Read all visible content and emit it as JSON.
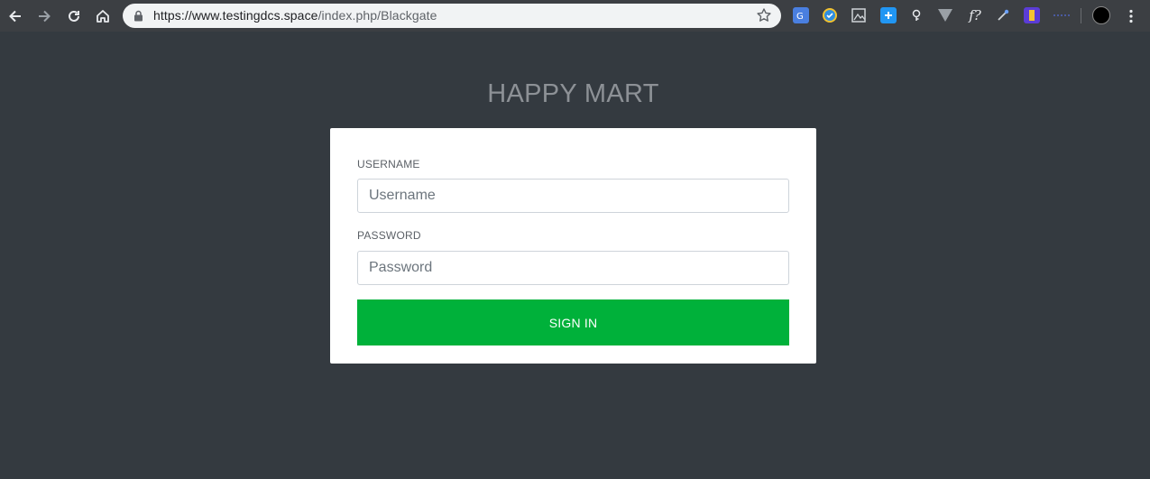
{
  "browser": {
    "url_host": "https://www.testingdcs.space",
    "url_path": "/index.php/Blackgate",
    "icons": {
      "back": "arrow-left-icon",
      "forward": "arrow-right-icon",
      "reload": "reload-icon",
      "home": "home-icon",
      "lock": "lock-icon",
      "bookmark": "star-icon",
      "menu": "vertical-dots-icon"
    }
  },
  "page": {
    "brand": "HAPPY MART",
    "username_label": "USERNAME",
    "username_placeholder": "Username",
    "password_label": "PASSWORD",
    "password_placeholder": "Password",
    "signin_label": "SIGN IN"
  },
  "colors": {
    "background": "#343a40",
    "card": "#ffffff",
    "button": "#00b13a",
    "brand_text": "#8d9196"
  }
}
